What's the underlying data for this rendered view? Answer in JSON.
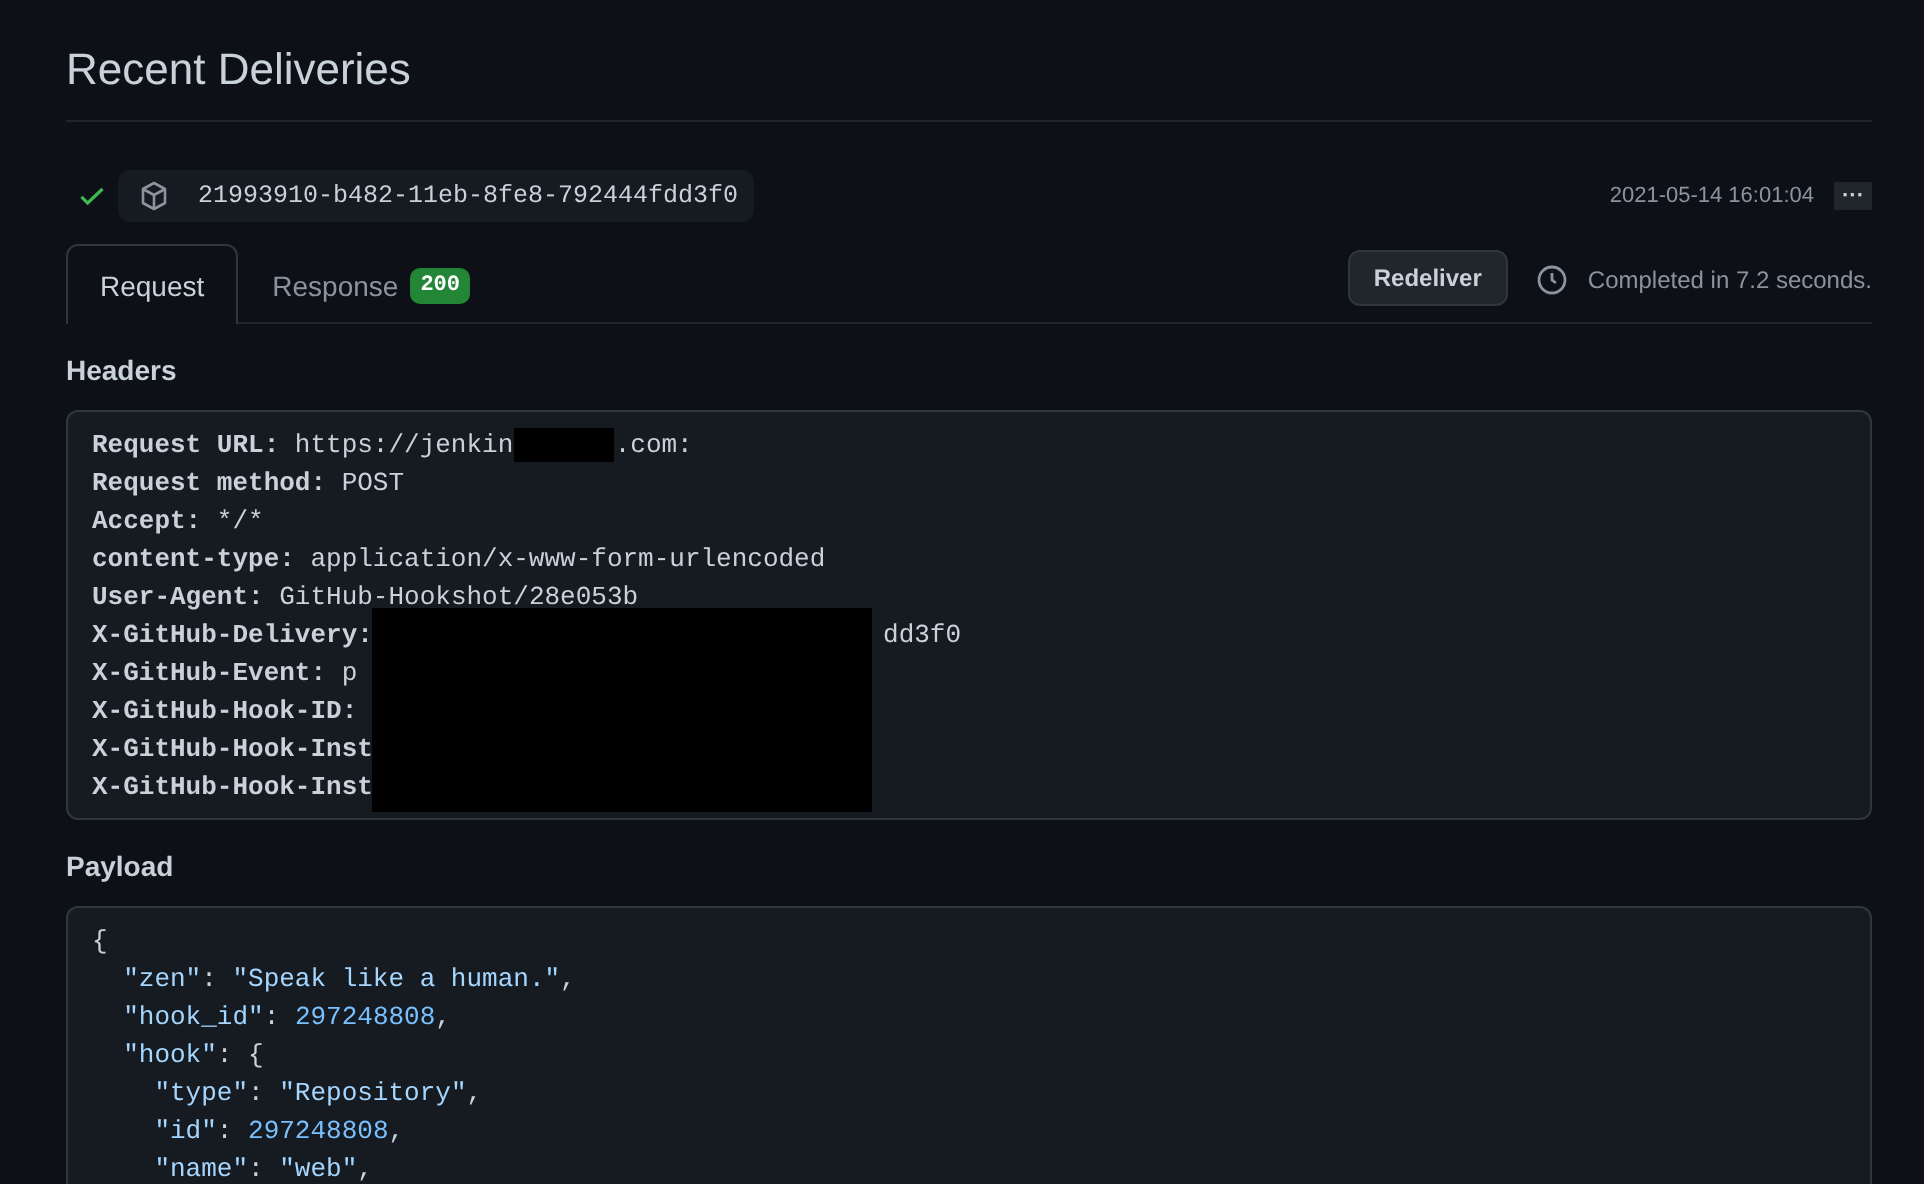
{
  "title": "Recent Deliveries",
  "delivery": {
    "kind": "success",
    "guid": "21993910-b482-11eb-8fe8-792444fdd3f0",
    "timestamp": "2021-05-14 16:01:04",
    "menu": "···"
  },
  "tabs": [
    {
      "label": "Request",
      "selected": true
    },
    {
      "label": "Response",
      "selected": false,
      "badge": "200"
    }
  ],
  "redeliver": "Redeliver",
  "completed": "Completed in 7.2 seconds.",
  "headers": {
    "title": "Headers",
    "redacted_block": true,
    "lines": [
      {
        "name": "Request URL:",
        "value": "https://jenkin",
        "redacted": true,
        "tail": ".com:"
      },
      {
        "name": "Request method:",
        "value": "POST"
      },
      {
        "name": "Accept:",
        "value": "*/*"
      },
      {
        "name": "content-type:",
        "value": "application/x-www-form-urlencoded"
      },
      {
        "name": "User-Agent:",
        "value": "GitHub-Hookshot/28e053b"
      },
      {
        "name": "X-GitHub-Delivery:",
        "redacted": true,
        "tail": "dd3f0"
      },
      {
        "name": "X-GitHub-Event:",
        "value": "p"
      },
      {
        "name": "X-GitHub-Hook-ID:"
      },
      {
        "name": "X-GitHub-Hook-Inst"
      },
      {
        "name": "X-GitHub-Hook-Inst"
      }
    ]
  },
  "payload": {
    "title": "Payload",
    "lines": [
      [
        {
          "kind": "punct",
          "text": "{"
        }
      ],
      [
        {
          "kind": "string",
          "text": "  \"zen\""
        },
        {
          "kind": "punct",
          "text": ": "
        },
        {
          "kind": "string",
          "text": "\"Speak like a human.\""
        },
        {
          "kind": "punct",
          "text": ","
        }
      ],
      [
        {
          "kind": "string",
          "text": "  \"hook_id\""
        },
        {
          "kind": "punct",
          "text": ": "
        },
        {
          "kind": "number",
          "text": "297248808"
        },
        {
          "kind": "punct",
          "text": ","
        }
      ],
      [
        {
          "kind": "string",
          "text": "  \"hook\""
        },
        {
          "kind": "punct",
          "text": ": {"
        }
      ],
      [
        {
          "kind": "string",
          "text": "    \"type\""
        },
        {
          "kind": "punct",
          "text": ": "
        },
        {
          "kind": "string",
          "text": "\"Repository\""
        },
        {
          "kind": "punct",
          "text": ","
        }
      ],
      [
        {
          "kind": "string",
          "text": "    \"id\""
        },
        {
          "kind": "punct",
          "text": ": "
        },
        {
          "kind": "number",
          "text": "297248808"
        },
        {
          "kind": "punct",
          "text": ","
        }
      ],
      [
        {
          "kind": "string",
          "text": "    \"name\""
        },
        {
          "kind": "punct",
          "text": ": "
        },
        {
          "kind": "string",
          "text": "\"web\""
        },
        {
          "kind": "punct",
          "text": ","
        }
      ]
    ]
  }
}
